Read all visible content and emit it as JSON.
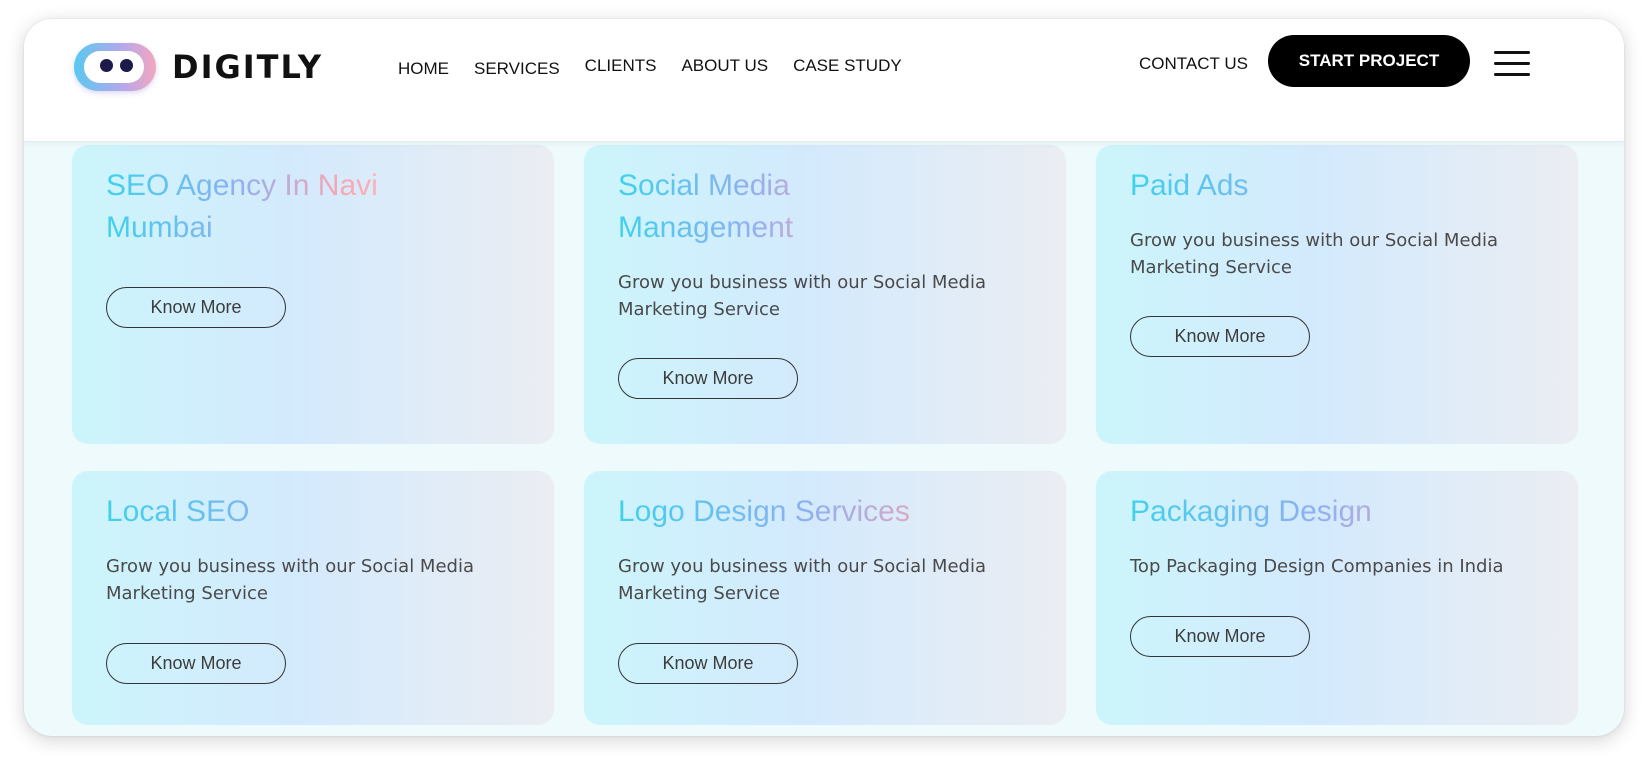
{
  "brand": {
    "name": "DIGITLY"
  },
  "nav": {
    "items": [
      {
        "label": "HOME"
      },
      {
        "label": "SERVICES"
      },
      {
        "label": "CLIENTS"
      },
      {
        "label": "ABOUT US"
      },
      {
        "label": "CASE STUDY"
      }
    ],
    "contact_label": "CONTACT US",
    "cta_label": "START PROJECT",
    "menu_icon": "hamburger-menu-icon"
  },
  "colors": {
    "page_background": "#eefafc",
    "title_gradient": [
      "#3fd1ee",
      "#8fb0f1",
      "#f7a6b4"
    ],
    "cta_background": "#000000",
    "cta_text": "#ffffff"
  },
  "cards": [
    {
      "title": "SEO Agency In Navi Mumbai",
      "description": "",
      "button_label": "Know More"
    },
    {
      "title": "Social Media Management",
      "description": "Grow you business with our Social Media Marketing Service",
      "button_label": "Know More"
    },
    {
      "title": "Paid Ads",
      "description": "Grow you business with our Social Media Marketing Service",
      "button_label": "Know More"
    },
    {
      "title": "Local SEO",
      "description": "Grow you business with our Social Media Marketing Service",
      "button_label": "Know More"
    },
    {
      "title": "Logo Design Services",
      "description": "Grow you business with our Social Media Marketing Service",
      "button_label": "Know More"
    },
    {
      "title": "Packaging Design",
      "description": "Top Packaging Design Companies in India",
      "button_label": "Know More"
    }
  ]
}
